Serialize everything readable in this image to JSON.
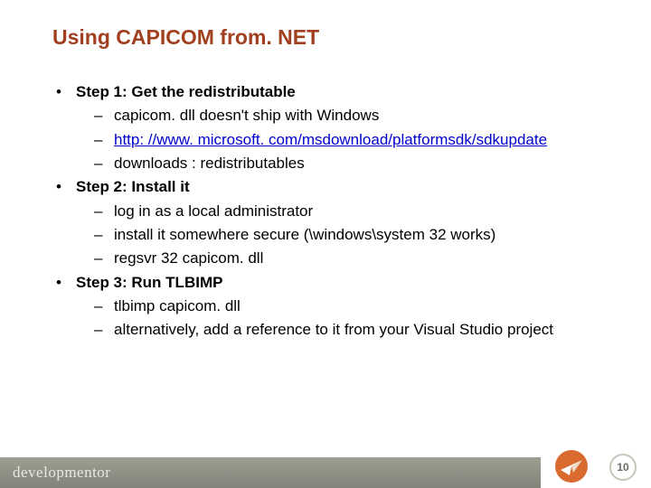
{
  "title": "Using CAPICOM from. NET",
  "steps": [
    {
      "label": "Step 1: Get the redistributable",
      "items": [
        {
          "text": "capicom. dll doesn't ship with Windows",
          "link": false
        },
        {
          "text": "http: //www. microsoft. com/msdownload/platformsdk/sdkupdate",
          "link": true
        },
        {
          "text": "downloads : redistributables",
          "link": false
        }
      ]
    },
    {
      "label": "Step 2: Install it",
      "items": [
        {
          "text": "log in as a local administrator",
          "link": false
        },
        {
          "text": "install it somewhere secure (\\windows\\system 32 works)",
          "link": false
        },
        {
          "text": "regsvr 32 capicom. dll",
          "link": false
        }
      ]
    },
    {
      "label": "Step 3: Run TLBIMP",
      "items": [
        {
          "text": "tlbimp capicom. dll",
          "link": false
        },
        {
          "text": "alternatively, add a reference to it from your Visual Studio project",
          "link": false
        }
      ]
    }
  ],
  "brand": "developmentor",
  "page_number": "10"
}
